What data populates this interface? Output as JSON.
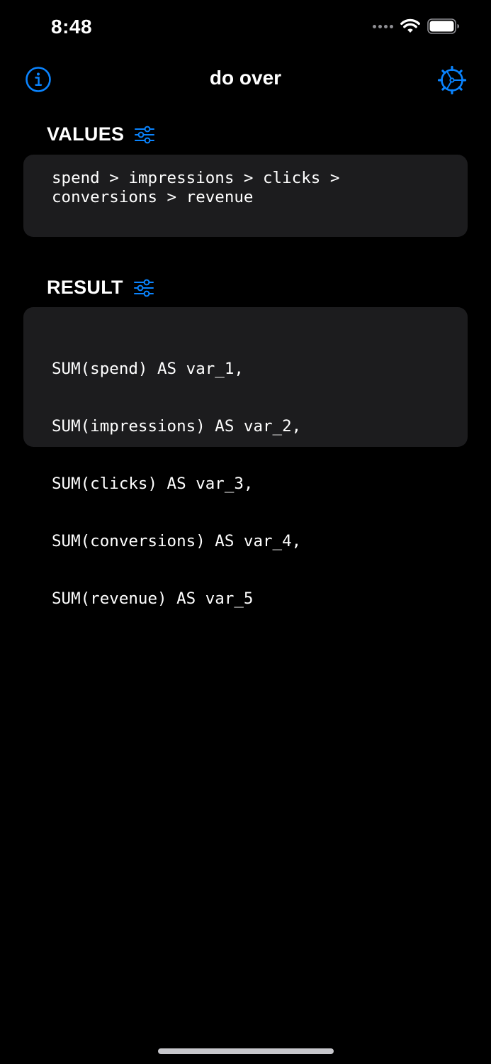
{
  "status_bar": {
    "time": "8:48"
  },
  "nav": {
    "title": "do over",
    "info_icon": "info-circle-icon",
    "settings_icon": "gear-icon"
  },
  "values": {
    "header": "VALUES",
    "text": "spend > impressions > clicks > conversions > revenue"
  },
  "result": {
    "header": "RESULT",
    "lines": [
      "SUM(spend) AS var_1,",
      "SUM(impressions) AS var_2,",
      "SUM(clicks) AS var_3,",
      "SUM(conversions) AS var_4,",
      "SUM(revenue) AS var_5"
    ]
  },
  "colors": {
    "background": "#000000",
    "card": "#1c1c1e",
    "accent": "#0a84ff",
    "text": "#ffffff"
  }
}
